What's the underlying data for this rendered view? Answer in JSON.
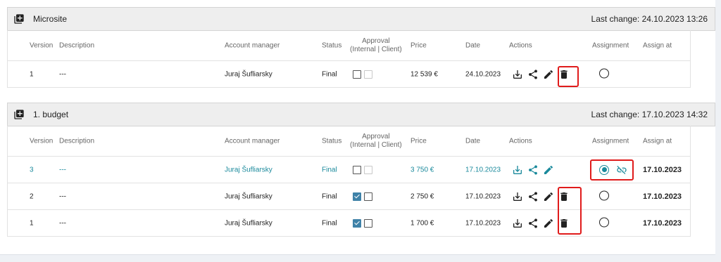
{
  "columns": {
    "version": "Version",
    "description": "Description",
    "manager": "Account manager",
    "status": "Status",
    "approval_line1": "Approval",
    "approval_line2": "(Internal | Client)",
    "price": "Price",
    "date": "Date",
    "actions": "Actions",
    "assignment": "Assignment",
    "assign_at": "Assign at"
  },
  "sections": [
    {
      "title": "Microsite",
      "last_change": "Last change: 24.10.2023 13:26",
      "rows": [
        {
          "version": "1",
          "description": "---",
          "manager": "Juraj Šufliarsky",
          "status": "Final",
          "price": "12 539 €",
          "date": "24.10.2023",
          "assign_at": ""
        }
      ]
    },
    {
      "title": "1. budget",
      "last_change": "Last change: 17.10.2023 14:32",
      "rows": [
        {
          "version": "3",
          "description": "---",
          "manager": "Juraj Šufliarsky",
          "status": "Final",
          "price": "3 750 €",
          "date": "17.10.2023",
          "assign_at": "17.10.2023"
        },
        {
          "version": "2",
          "description": "---",
          "manager": "Juraj Šufliarsky",
          "status": "Final",
          "price": "2 750 €",
          "date": "17.10.2023",
          "assign_at": "17.10.2023"
        },
        {
          "version": "1",
          "description": "---",
          "manager": "Juraj Šufliarsky",
          "status": "Final",
          "price": "1 700 €",
          "date": "17.10.2023",
          "assign_at": "17.10.2023"
        }
      ]
    }
  ],
  "icons": {
    "add": "add-box-icon",
    "download": "download-icon",
    "share": "share-icon",
    "edit": "edit-icon",
    "delete": "delete-icon",
    "unlink": "unlink-icon"
  },
  "colors": {
    "accent": "#1b8a9c",
    "highlight": "#e01b1b",
    "checked": "#3f82a8"
  }
}
